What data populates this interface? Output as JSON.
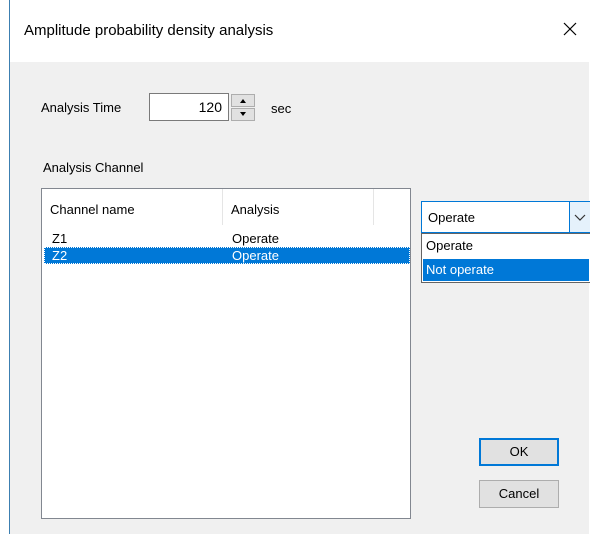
{
  "window": {
    "title": "Amplitude probability density analysis",
    "close_icon": "close-icon"
  },
  "analysis_time": {
    "label": "Analysis Time",
    "value": "120",
    "unit": "sec",
    "up_icon": "spin-up-icon",
    "down_icon": "spin-down-icon"
  },
  "channel_section": {
    "label": "Analysis Channel",
    "columns": [
      "Channel name",
      "Analysis"
    ],
    "rows": [
      {
        "channel": "Z1",
        "analysis": "Operate",
        "selected": false
      },
      {
        "channel": "Z2",
        "analysis": "Operate",
        "selected": true
      }
    ]
  },
  "combo": {
    "selected": "Operate",
    "options": [
      "Operate",
      "Not operate"
    ],
    "highlighted": "Not operate",
    "arrow_icon": "chevron-down-icon"
  },
  "buttons": {
    "ok": "OK",
    "cancel": "Cancel"
  },
  "colors": {
    "accent": "#0078d7",
    "dialog_bg": "#f0f0f0",
    "button_bg": "#e1e1e1"
  }
}
